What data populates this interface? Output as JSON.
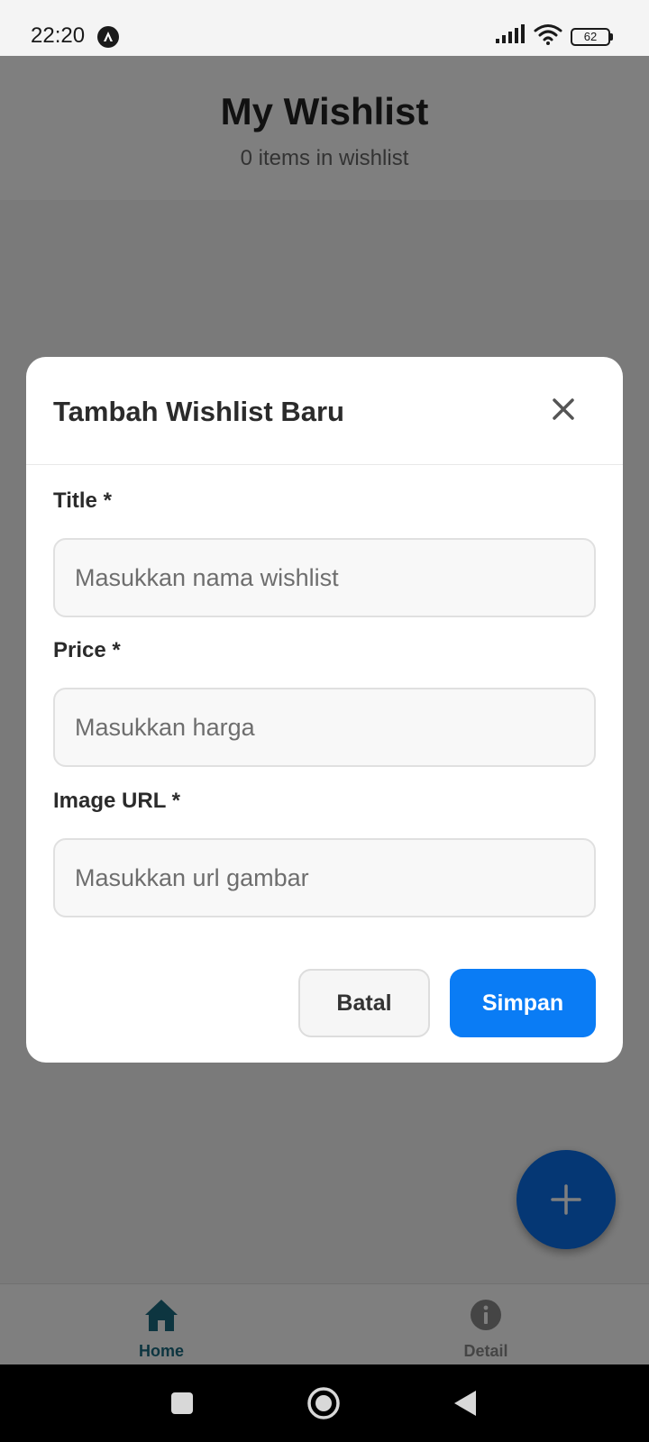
{
  "status_bar": {
    "time": "22:20",
    "battery": "62"
  },
  "app": {
    "title": "My Wishlist",
    "subtitle": "0 items in wishlist",
    "accent_color": "#0a7cf5"
  },
  "modal": {
    "title": "Tambah Wishlist Baru",
    "fields": [
      {
        "label": "Title *",
        "placeholder": "Masukkan nama wishlist",
        "value": ""
      },
      {
        "label": "Price *",
        "placeholder": "Masukkan harga",
        "value": ""
      },
      {
        "label": "Image URL *",
        "placeholder": "Masukkan url gambar",
        "value": ""
      }
    ],
    "cancel_label": "Batal",
    "save_label": "Simpan"
  },
  "fab": {
    "icon": "plus-icon"
  },
  "bottom_nav": {
    "items": [
      {
        "label": "Home",
        "icon": "home-icon",
        "active": true
      },
      {
        "label": "Detail",
        "icon": "info-icon",
        "active": false
      }
    ]
  },
  "system_nav": {
    "buttons": [
      "recents-icon",
      "home-circle-icon",
      "back-icon"
    ]
  }
}
